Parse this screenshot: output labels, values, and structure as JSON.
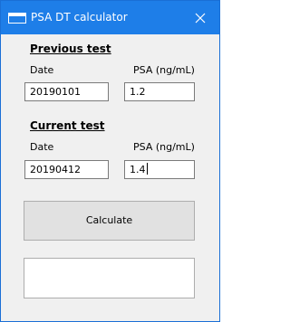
{
  "window": {
    "title": "PSA DT calculator"
  },
  "previous_test": {
    "heading": "Previous test",
    "date_label": "Date",
    "psa_label": "PSA (ng/mL)",
    "date_value": "20190101",
    "psa_value": "1.2"
  },
  "current_test": {
    "heading": "Current test",
    "date_label": "Date",
    "psa_label": "PSA (ng/mL)",
    "date_value": "20190412",
    "psa_value": "1.4"
  },
  "actions": {
    "calculate_label": "Calculate"
  },
  "result": {
    "text": ""
  },
  "icons": {
    "app": "window-icon",
    "close": "close-icon"
  },
  "colors": {
    "titlebar": "#1e7ee8",
    "window_bg": "#f0f0f0",
    "button_bg": "#e1e1e1"
  }
}
